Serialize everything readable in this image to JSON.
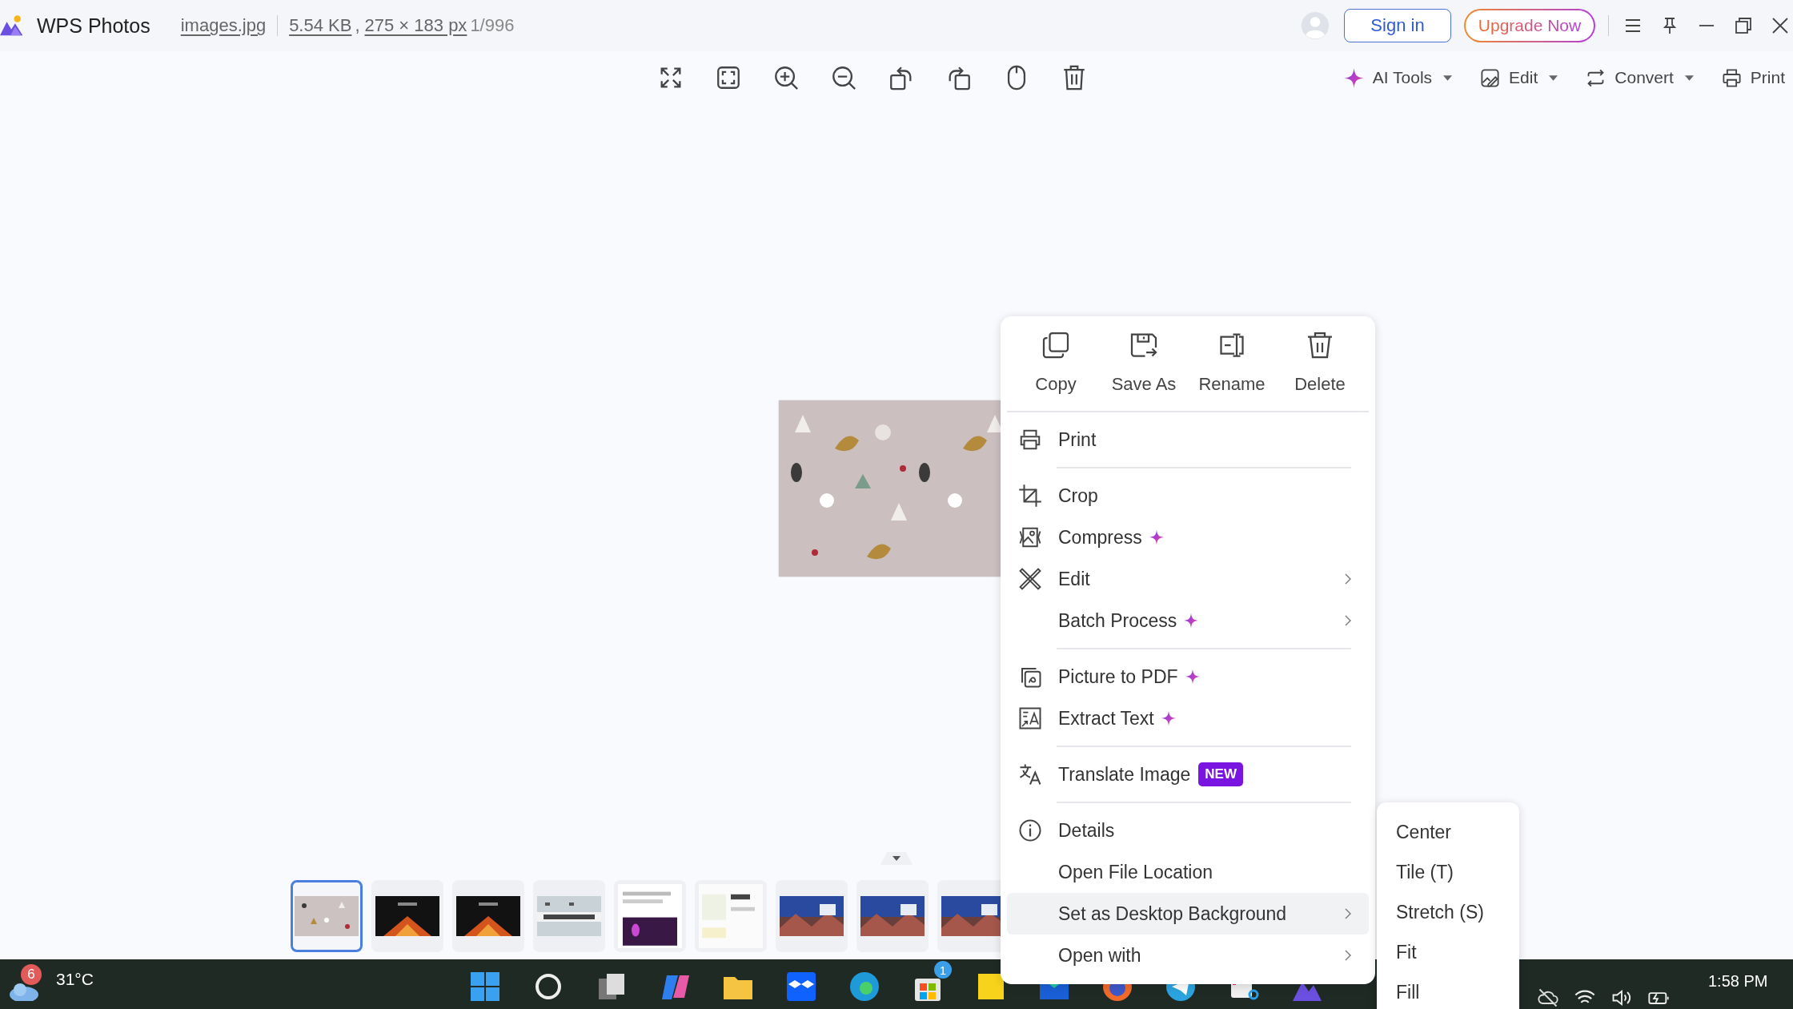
{
  "app": {
    "name": "WPS Photos"
  },
  "file": {
    "name": "images.jpg",
    "size": "5.54 KB",
    "separator": ",",
    "dimensions": "275 × 183 px",
    "position": "1/996"
  },
  "account": {
    "sign_in": "Sign in",
    "upgrade": "Upgrade Now"
  },
  "toolbar": {
    "tools": [
      {
        "label": "AI Tools",
        "dropdown": true
      },
      {
        "label": "Edit",
        "dropdown": true
      },
      {
        "label": "Convert",
        "dropdown": true
      },
      {
        "label": "Print",
        "dropdown": false
      }
    ]
  },
  "context_menu": {
    "actions": [
      "Copy",
      "Save As",
      "Rename",
      "Delete"
    ],
    "items": [
      {
        "label": "Print",
        "selected": false,
        "divider_after": true
      },
      {
        "label": "Crop",
        "selected": false
      },
      {
        "label": "Compress",
        "selected": false,
        "ai": true
      },
      {
        "label": "Edit",
        "selected": false,
        "submenu": true
      },
      {
        "label": "Batch Process",
        "selected": false,
        "ai": true,
        "submenu": true,
        "divider_after": true
      },
      {
        "label": "Picture to PDF",
        "selected": false,
        "ai": true
      },
      {
        "label": "Extract Text",
        "selected": false,
        "ai": true,
        "divider_after": true
      },
      {
        "label": "Translate Image",
        "selected": false,
        "badge": "NEW",
        "divider_after": true
      },
      {
        "label": "Details",
        "selected": false
      },
      {
        "label": "Open File Location",
        "selected": false
      },
      {
        "label": "Set as Desktop Background",
        "selected": true,
        "submenu": true
      },
      {
        "label": "Open with",
        "selected": false,
        "submenu": true
      }
    ]
  },
  "submenu": {
    "items": [
      "Center",
      "Tile (T)",
      "Stretch (S)",
      "Fit",
      "Fill"
    ]
  },
  "thumbnails": [
    {
      "selected": true
    },
    {
      "selected": false
    },
    {
      "selected": false
    },
    {
      "selected": false
    },
    {
      "selected": false
    },
    {
      "selected": false
    },
    {
      "selected": false
    },
    {
      "selected": false
    },
    {
      "selected": false
    }
  ],
  "taskbar": {
    "weather": {
      "badge": "6",
      "temperature": "31°C"
    },
    "store_badge": "1",
    "time": "1:58 PM"
  }
}
